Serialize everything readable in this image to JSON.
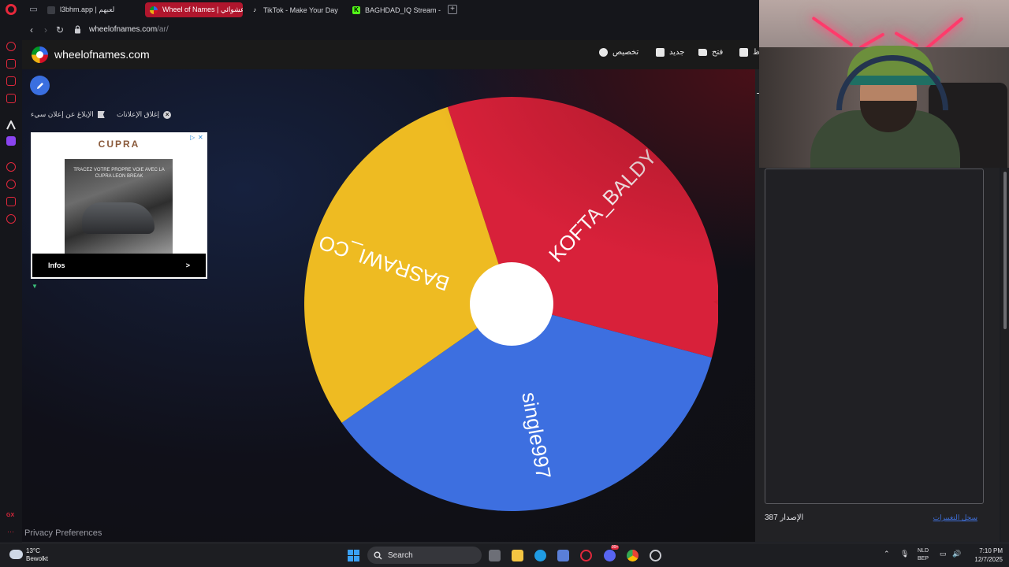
{
  "browser": {
    "tabs": [
      {
        "label": "l3bhm.app | لعبهم",
        "active": false,
        "favicon": "l3bhm-icon"
      },
      {
        "label": "Wheel of Names | عشوائي",
        "active": true,
        "favicon": "wheel-icon"
      },
      {
        "label": "TikTok - Make Your Day",
        "active": false,
        "favicon": "tiktok-icon"
      },
      {
        "label": "BAGHDAD_IQ Stream - W",
        "active": false,
        "favicon": "kick-icon"
      }
    ],
    "url_host": "wheelofnames.com",
    "url_path": "/ar/",
    "accent": "#e0283c"
  },
  "site": {
    "name": "wheelofnames.com",
    "toolbar": {
      "customize": "تخصيص",
      "new": "جديد",
      "open": "فتح",
      "save": "حفظ"
    }
  },
  "ads": {
    "close_ads": "إغلاق الإعلانات",
    "report_ad": "الإبلاغ عن إعلان سيء",
    "brand": "CUPRA",
    "caption": "TRACEZ VOTRE PROPRE VOIE AVEC LA CUPRA LEON BREAK",
    "infos": "Infos",
    "infos_arrow": ">"
  },
  "wheel": {
    "segments": [
      {
        "label": "KOFTA_BALDY",
        "color": "#d8213a"
      },
      {
        "label": "single997",
        "color": "#3d6fe0"
      },
      {
        "label": "BASRAWI_CO",
        "color": "#eebb22"
      }
    ],
    "pointer_color": "#d01f33"
  },
  "panel": {
    "version_label": "الإصدار",
    "version_number": "387",
    "changelog": "سجل التغييرات"
  },
  "footer": {
    "privacy": "Privacy Preferences"
  },
  "taskbar": {
    "temperature": "13°C",
    "weather": "Bewolkt",
    "search": "Search",
    "lang_1": "NLD",
    "lang_2": "BEP",
    "time": "7:10 PM",
    "date": "12/7/2025",
    "discord_badge": "99+"
  }
}
